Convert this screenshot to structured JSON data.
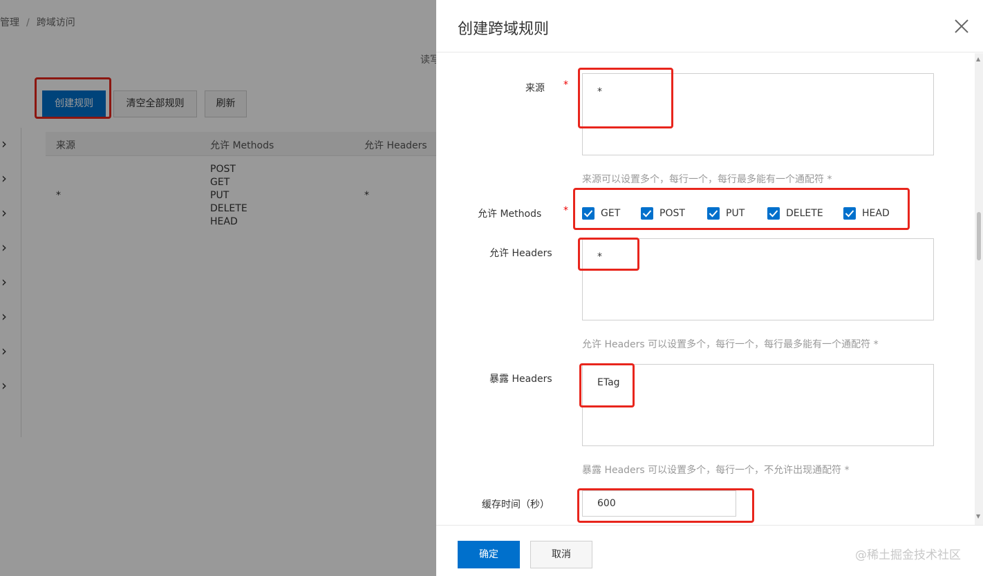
{
  "background": {
    "breadcrumb": {
      "parent": "管理",
      "separator": "/",
      "current": "跨域访问"
    },
    "clipped_text": "读写",
    "toolbar": {
      "create": "创建规则",
      "clear_all": "清空全部规则",
      "refresh": "刷新"
    },
    "table": {
      "headers": [
        "来源",
        "允许 Methods",
        "允许 Headers"
      ],
      "row": {
        "source": "*",
        "methods": [
          "POST",
          "GET",
          "PUT",
          "DELETE",
          "HEAD"
        ],
        "headers": "*"
      }
    },
    "expand_icons": [
      "chevron-right-icon",
      "chevron-right-icon",
      "chevron-right-icon",
      "chevron-right-icon",
      "chevron-right-icon",
      "chevron-right-icon",
      "chevron-right-icon",
      "chevron-right-icon"
    ]
  },
  "drawer": {
    "title": "创建跨域规则",
    "close_icon": "close-icon",
    "form": {
      "source": {
        "label": "来源",
        "required": "*",
        "value": "*",
        "hint": "来源可以设置多个，每行一个，每行最多能有一个通配符 *"
      },
      "methods": {
        "label": "允许 Methods",
        "required": "*",
        "options": [
          {
            "label": "GET",
            "checked": true
          },
          {
            "label": "POST",
            "checked": true
          },
          {
            "label": "PUT",
            "checked": true
          },
          {
            "label": "DELETE",
            "checked": true
          },
          {
            "label": "HEAD",
            "checked": true
          }
        ]
      },
      "allow_headers": {
        "label": "允许 Headers",
        "value": "*",
        "hint": "允许 Headers 可以设置多个，每行一个，每行最多能有一个通配符 *"
      },
      "expose_headers": {
        "label": "暴露 Headers",
        "value": "ETag",
        "hint": "暴露 Headers 可以设置多个，每行一个，不允许出现通配符 *"
      },
      "cache_time": {
        "label": "缓存时间（秒）",
        "value": "600"
      }
    },
    "footer": {
      "confirm": "确定",
      "cancel": "取消"
    }
  },
  "watermark": "@稀土掘金技术社区",
  "colors": {
    "primary": "#0070cc",
    "highlight": "#e8251c",
    "required": "#ee0000",
    "overlay": "rgba(0,0,0,0.40)"
  }
}
